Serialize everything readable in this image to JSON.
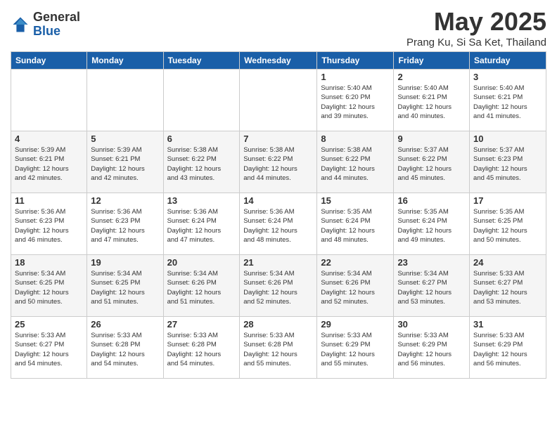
{
  "header": {
    "logo_general": "General",
    "logo_blue": "Blue",
    "month_title": "May 2025",
    "location": "Prang Ku, Si Sa Ket, Thailand"
  },
  "days_of_week": [
    "Sunday",
    "Monday",
    "Tuesday",
    "Wednesday",
    "Thursday",
    "Friday",
    "Saturday"
  ],
  "weeks": [
    [
      {
        "day": "",
        "info": ""
      },
      {
        "day": "",
        "info": ""
      },
      {
        "day": "",
        "info": ""
      },
      {
        "day": "",
        "info": ""
      },
      {
        "day": "1",
        "info": "Sunrise: 5:40 AM\nSunset: 6:20 PM\nDaylight: 12 hours\nand 39 minutes."
      },
      {
        "day": "2",
        "info": "Sunrise: 5:40 AM\nSunset: 6:21 PM\nDaylight: 12 hours\nand 40 minutes."
      },
      {
        "day": "3",
        "info": "Sunrise: 5:40 AM\nSunset: 6:21 PM\nDaylight: 12 hours\nand 41 minutes."
      }
    ],
    [
      {
        "day": "4",
        "info": "Sunrise: 5:39 AM\nSunset: 6:21 PM\nDaylight: 12 hours\nand 42 minutes."
      },
      {
        "day": "5",
        "info": "Sunrise: 5:39 AM\nSunset: 6:21 PM\nDaylight: 12 hours\nand 42 minutes."
      },
      {
        "day": "6",
        "info": "Sunrise: 5:38 AM\nSunset: 6:22 PM\nDaylight: 12 hours\nand 43 minutes."
      },
      {
        "day": "7",
        "info": "Sunrise: 5:38 AM\nSunset: 6:22 PM\nDaylight: 12 hours\nand 44 minutes."
      },
      {
        "day": "8",
        "info": "Sunrise: 5:38 AM\nSunset: 6:22 PM\nDaylight: 12 hours\nand 44 minutes."
      },
      {
        "day": "9",
        "info": "Sunrise: 5:37 AM\nSunset: 6:22 PM\nDaylight: 12 hours\nand 45 minutes."
      },
      {
        "day": "10",
        "info": "Sunrise: 5:37 AM\nSunset: 6:23 PM\nDaylight: 12 hours\nand 45 minutes."
      }
    ],
    [
      {
        "day": "11",
        "info": "Sunrise: 5:36 AM\nSunset: 6:23 PM\nDaylight: 12 hours\nand 46 minutes."
      },
      {
        "day": "12",
        "info": "Sunrise: 5:36 AM\nSunset: 6:23 PM\nDaylight: 12 hours\nand 47 minutes."
      },
      {
        "day": "13",
        "info": "Sunrise: 5:36 AM\nSunset: 6:24 PM\nDaylight: 12 hours\nand 47 minutes."
      },
      {
        "day": "14",
        "info": "Sunrise: 5:36 AM\nSunset: 6:24 PM\nDaylight: 12 hours\nand 48 minutes."
      },
      {
        "day": "15",
        "info": "Sunrise: 5:35 AM\nSunset: 6:24 PM\nDaylight: 12 hours\nand 48 minutes."
      },
      {
        "day": "16",
        "info": "Sunrise: 5:35 AM\nSunset: 6:24 PM\nDaylight: 12 hours\nand 49 minutes."
      },
      {
        "day": "17",
        "info": "Sunrise: 5:35 AM\nSunset: 6:25 PM\nDaylight: 12 hours\nand 50 minutes."
      }
    ],
    [
      {
        "day": "18",
        "info": "Sunrise: 5:34 AM\nSunset: 6:25 PM\nDaylight: 12 hours\nand 50 minutes."
      },
      {
        "day": "19",
        "info": "Sunrise: 5:34 AM\nSunset: 6:25 PM\nDaylight: 12 hours\nand 51 minutes."
      },
      {
        "day": "20",
        "info": "Sunrise: 5:34 AM\nSunset: 6:26 PM\nDaylight: 12 hours\nand 51 minutes."
      },
      {
        "day": "21",
        "info": "Sunrise: 5:34 AM\nSunset: 6:26 PM\nDaylight: 12 hours\nand 52 minutes."
      },
      {
        "day": "22",
        "info": "Sunrise: 5:34 AM\nSunset: 6:26 PM\nDaylight: 12 hours\nand 52 minutes."
      },
      {
        "day": "23",
        "info": "Sunrise: 5:34 AM\nSunset: 6:27 PM\nDaylight: 12 hours\nand 53 minutes."
      },
      {
        "day": "24",
        "info": "Sunrise: 5:33 AM\nSunset: 6:27 PM\nDaylight: 12 hours\nand 53 minutes."
      }
    ],
    [
      {
        "day": "25",
        "info": "Sunrise: 5:33 AM\nSunset: 6:27 PM\nDaylight: 12 hours\nand 54 minutes."
      },
      {
        "day": "26",
        "info": "Sunrise: 5:33 AM\nSunset: 6:28 PM\nDaylight: 12 hours\nand 54 minutes."
      },
      {
        "day": "27",
        "info": "Sunrise: 5:33 AM\nSunset: 6:28 PM\nDaylight: 12 hours\nand 54 minutes."
      },
      {
        "day": "28",
        "info": "Sunrise: 5:33 AM\nSunset: 6:28 PM\nDaylight: 12 hours\nand 55 minutes."
      },
      {
        "day": "29",
        "info": "Sunrise: 5:33 AM\nSunset: 6:29 PM\nDaylight: 12 hours\nand 55 minutes."
      },
      {
        "day": "30",
        "info": "Sunrise: 5:33 AM\nSunset: 6:29 PM\nDaylight: 12 hours\nand 56 minutes."
      },
      {
        "day": "31",
        "info": "Sunrise: 5:33 AM\nSunset: 6:29 PM\nDaylight: 12 hours\nand 56 minutes."
      }
    ]
  ]
}
